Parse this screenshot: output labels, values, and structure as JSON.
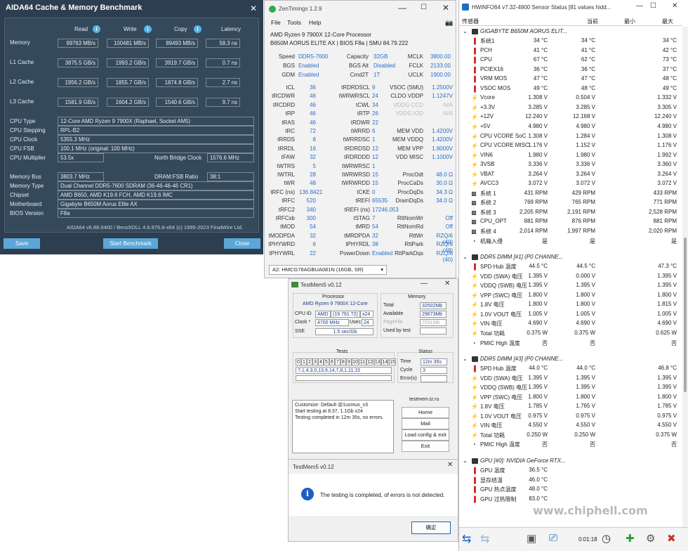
{
  "aida": {
    "title": "AIDA64 Cache & Memory Benchmark",
    "headers": {
      "read": "Read",
      "write": "Write",
      "copy": "Copy",
      "latency": "Latency"
    },
    "rows": [
      {
        "label": "Memory",
        "read": "99763 MB/s",
        "write": "100481 MB/s",
        "copy": "89493 MB/s",
        "latency": "58.3 ns"
      },
      {
        "label": "L1 Cache",
        "read": "3875.5 GB/s",
        "write": "1993.2 GB/s",
        "copy": "3919.7 GB/s",
        "latency": "0.7 ns"
      },
      {
        "label": "L2 Cache",
        "read": "1956.2 GB/s",
        "write": "1855.7 GB/s",
        "copy": "1874.8 GB/s",
        "latency": "2.7 ns"
      },
      {
        "label": "L3 Cache",
        "read": "1581.9 GB/s",
        "write": "1604.2 GB/s",
        "copy": "1540.6 GB/s",
        "latency": "9.7 ns"
      }
    ],
    "cpu_type_label": "CPU Type",
    "cpu_type": "12-Core AMD Ryzen 9 7900X  (Raphael, Socket AM5)",
    "cpu_stepping_label": "CPU Stepping",
    "cpu_stepping": "RPL-B2",
    "cpu_clock_label": "CPU Clock",
    "cpu_clock": "5355.3 MHz",
    "cpu_fsb_label": "CPU FSB",
    "cpu_fsb": "100.1 MHz  (original: 100 MHz)",
    "cpu_mult_label": "CPU Multiplier",
    "cpu_mult": "53.5x",
    "nb_clock_label": "North Bridge Clock",
    "nb_clock": "1576.6 MHz",
    "mem_bus_label": "Memory Bus",
    "mem_bus": "3803.7 MHz",
    "dram_ratio_label": "DRAM:FSB Ratio",
    "dram_ratio": "38:1",
    "mem_type_label": "Memory Type",
    "mem_type": "Dual Channel DDR5-7600 SDRAM  (36-46-46-46 CR1)",
    "chipset_label": "Chipset",
    "chipset": "AMD B650, AMD K19.6 FCH, AMD K19.6 IMC",
    "mobo_label": "Motherboard",
    "mobo": "Gigabyte B650M Aorus Elite AX",
    "bios_label": "BIOS Version",
    "bios": "F8a",
    "footer": "AIDA64 v6.88.6400 / BenchDLL 4.6.876.8-x64  (c) 1995-2023 FinalWire Ltd.",
    "save": "Save",
    "start": "Start Benchmark",
    "close": "Close"
  },
  "zen": {
    "title": "ZenTimings 1.2.9",
    "menu": [
      "File",
      "Tools",
      "Help"
    ],
    "cpu": "AMD Ryzen 9 7900X 12-Core Processor",
    "board": "B650M AORUS ELITE AX | BIOS F8a | SMU 84.79.222",
    "top": [
      [
        "Speed",
        "DDR5-7600",
        "Capacity",
        "32GB",
        "MCLK",
        "3800.00"
      ],
      [
        "BGS",
        "Enabled",
        "BGS Alt",
        "Disabled",
        "FCLK",
        "2133.00"
      ],
      [
        "GDM",
        "Enabled",
        "Cmd2T",
        "1T",
        "UCLK",
        "1900.00"
      ]
    ],
    "timings": [
      [
        "tCL",
        "36",
        "tRDRDSCL",
        "9",
        "VSOC (SMU)",
        "1.2500V"
      ],
      [
        "tRCDWR",
        "46",
        "tWRWRSCL",
        "24",
        "CLDO VDDP",
        "1.1247V"
      ],
      [
        "tRCDRD",
        "46",
        "tCWL",
        "34",
        "VDDG CCD",
        "N/A"
      ],
      [
        "tRP",
        "46",
        "tRTP",
        "26",
        "VDDG IOD",
        "N/A"
      ],
      [
        "tRAS",
        "46",
        "tRDWR",
        "22",
        "",
        ""
      ],
      [
        "tRC",
        "72",
        "tWRRD",
        "6",
        "MEM VDD",
        "1.4200V"
      ],
      [
        "tRRDS",
        "8",
        "tWRRDSC",
        "1",
        "MEM VDDQ",
        "1.4200V"
      ],
      [
        "tRRDL",
        "16",
        "tRDRDSD",
        "12",
        "MEM VPP",
        "1.8000V"
      ],
      [
        "tFAW",
        "32",
        "tRDRDDD",
        "12",
        "VDD MISC",
        "1.1000V"
      ],
      [
        "tWTRS",
        "5",
        "tWRWRSC",
        "1",
        "",
        ""
      ],
      [
        "tWTRL",
        "28",
        "tWRWRSD",
        "15",
        "ProcOdt",
        "48.0 Ω"
      ],
      [
        "tWR",
        "48",
        "tWRWRDD",
        "15",
        "ProcCaDs",
        "30.0 Ω"
      ],
      [
        "tRFC (ns)",
        "136.8421",
        "tCKE",
        "0",
        "ProcDqDs",
        "34.3 Ω"
      ],
      [
        "tRFC",
        "520",
        "tREFI",
        "65535",
        "DramDqDs",
        "34.0 Ω"
      ],
      [
        "tRFC2",
        "340",
        "tREFI (ns)",
        "17246.053",
        "",
        ""
      ],
      [
        "tRFCsb",
        "300",
        "tSTAG",
        "7",
        "RttNomWr",
        "Off"
      ],
      [
        "tMOD",
        "54",
        "tMRD",
        "54",
        "RttNomRd",
        "Off"
      ],
      [
        "tMODPDA",
        "32",
        "tMRDPDA",
        "32",
        "RttWr",
        "RZQ/6 (40)"
      ],
      [
        "tPHYWRD",
        "6",
        "tPHYRDL",
        "38",
        "RttPark",
        "RZQ/5 (48)"
      ],
      [
        "tPHYWRL",
        "22",
        "PowerDown",
        "Enabled",
        "RttParkDqs",
        "RZQ/6 (40)"
      ]
    ],
    "dimm": "A2: HMCG78AGBUA081N (16GB, SR)"
  },
  "tm5": {
    "title": "TestMem5 v0.12",
    "processor_label": "Processor",
    "processor": "AMD Ryzen 9 7900X 12-Core",
    "cpuid_label": "CPU ID",
    "cpuid_vendor": "AMD",
    "cpuid": "(19 761 ?2)",
    "cpuid_threads": "x24",
    "clock_label": "Clock *",
    "clock": "4700 MHz",
    "usec_label": "Usec",
    "usec": "24",
    "sse_label": "SSE",
    "sse": "1.5 sec/Gb",
    "memory_label": "Memory",
    "total_label": "Total",
    "total": "32502Mb",
    "avail_label": "Available",
    "avail": "29673Mb",
    "pagefile_label": "PageFile",
    "pagefile": "7031Mb",
    "used_label": "Used by test",
    "used": "",
    "tests_label": "Tests",
    "test_nums": [
      "0",
      "1",
      "2",
      "3",
      "4",
      "5",
      "6",
      "7",
      "8",
      "9",
      "10",
      "11",
      "12",
      "13",
      "14",
      "15"
    ],
    "test_seq": "?,1,4,3,0,13,9,14,7,8,1,11,15",
    "status_label": "Status",
    "time_label": "Time",
    "time": "12m 35s",
    "cycle_label": "Cycle",
    "cycle": "3",
    "errors_label": "Error(s)",
    "errors": "",
    "log": [
      "Customize: Default @1usmus_v3",
      "Start testing at 8:37, 1.1Gb x24",
      "Testing completed in 12m 35s, no errors."
    ],
    "site": "testmem.tz.ru",
    "home": "Home",
    "mail": "Mail",
    "load": "Load config & exit",
    "exit": "Exit"
  },
  "dialog": {
    "title": "TestMem5 v0.12",
    "message": "The testing is completed, of errors is not detected.",
    "ok": "确定"
  },
  "hw": {
    "title": "HWiNFO64 v7.32-4900 Sensor Status [81 values hidd...",
    "col_sensor": "传感器",
    "col_cur": "当前",
    "col_min": "最小",
    "col_max": "最大",
    "groups": [
      {
        "name": "GIGABYTE B650M AORUS ELIT...",
        "rows": [
          {
            "icon": "temp",
            "n": "系统1",
            "c": "34 °C",
            "mn": "34 °C",
            "mx": "34 °C"
          },
          {
            "icon": "temp",
            "n": "PCH",
            "c": "41 °C",
            "mn": "41 °C",
            "mx": "42 °C"
          },
          {
            "icon": "temp",
            "n": "CPU",
            "c": "67 °C",
            "mn": "62 °C",
            "mx": "73 °C"
          },
          {
            "icon": "temp",
            "n": "PCIEX16",
            "c": "36 °C",
            "mn": "36 °C",
            "mx": "37 °C"
          },
          {
            "icon": "temp",
            "n": "VRM MOS",
            "c": "47 °C",
            "mn": "47 °C",
            "mx": "48 °C"
          },
          {
            "icon": "temp",
            "n": "VSOC MOS",
            "c": "49 °C",
            "mn": "48 °C",
            "mx": "49 °C"
          },
          {
            "icon": "volt",
            "n": "Vcore",
            "c": "1.308 V",
            "mn": "0.504 V",
            "mx": "1.332 V"
          },
          {
            "icon": "volt",
            "n": "+3.3V",
            "c": "3.285 V",
            "mn": "3.285 V",
            "mx": "3.305 V"
          },
          {
            "icon": "volt",
            "n": "+12V",
            "c": "12.240 V",
            "mn": "12.168 V",
            "mx": "12.240 V"
          },
          {
            "icon": "volt",
            "n": "+5V",
            "c": "4.980 V",
            "mn": "4.980 V",
            "mx": "4.980 V"
          },
          {
            "icon": "volt",
            "n": "CPU VCORE SoC",
            "c": "1.308 V",
            "mn": "1.284 V",
            "mx": "1.308 V"
          },
          {
            "icon": "volt",
            "n": "CPU VCORE MISC",
            "c": "1.176 V",
            "mn": "1.152 V",
            "mx": "1.176 V"
          },
          {
            "icon": "volt",
            "n": "VIN6",
            "c": "1.980 V",
            "mn": "1.980 V",
            "mx": "1.992 V"
          },
          {
            "icon": "volt",
            "n": "3VSB",
            "c": "3.336 V",
            "mn": "3.336 V",
            "mx": "3.360 V"
          },
          {
            "icon": "volt",
            "n": "VBAT",
            "c": "3.264 V",
            "mn": "3.264 V",
            "mx": "3.264 V"
          },
          {
            "icon": "volt",
            "n": "AVCC3",
            "c": "3.072 V",
            "mn": "3.072 V",
            "mx": "3.072 V"
          },
          {
            "icon": "fan",
            "n": "系统 1",
            "c": "431 RPM",
            "mn": "429 RPM",
            "mx": "433 RPM"
          },
          {
            "icon": "fan",
            "n": "系统 2",
            "c": "769 RPM",
            "mn": "765 RPM",
            "mx": "771 RPM"
          },
          {
            "icon": "fan",
            "n": "系统 3",
            "c": "2,205 RPM",
            "mn": "2,191 RPM",
            "mx": "2,528 RPM"
          },
          {
            "icon": "fan",
            "n": "CPU_OPT",
            "c": "881 RPM",
            "mn": "876 RPM",
            "mx": "881 RPM"
          },
          {
            "icon": "fan",
            "n": "系统 4",
            "c": "2,014 RPM",
            "mn": "1,997 RPM",
            "mx": "2,020 RPM"
          },
          {
            "icon": "other",
            "n": "机箱入侵",
            "c": "是",
            "mn": "是",
            "mx": "是"
          }
        ]
      },
      {
        "name": "DDR5 DIMM [#1] (P0 CHANNE...",
        "rows": [
          {
            "icon": "temp",
            "n": "SPD Hub 温度",
            "c": "44.5 °C",
            "mn": "44.5 °C",
            "mx": "47.3 °C"
          },
          {
            "icon": "volt",
            "n": "VDD (SWA) 电压",
            "c": "1.395 V",
            "mn": "0.000 V",
            "mx": "1.395 V"
          },
          {
            "icon": "volt",
            "n": "VDDQ (SWB) 电压",
            "c": "1.395 V",
            "mn": "1.395 V",
            "mx": "1.395 V"
          },
          {
            "icon": "volt",
            "n": "VPP (SWC) 电压",
            "c": "1.800 V",
            "mn": "1.800 V",
            "mx": "1.800 V"
          },
          {
            "icon": "volt",
            "n": "1.8V 电压",
            "c": "1.800 V",
            "mn": "1.800 V",
            "mx": "1.815 V"
          },
          {
            "icon": "volt",
            "n": "1.0V VOUT 电压",
            "c": "1.005 V",
            "mn": "1.005 V",
            "mx": "1.005 V"
          },
          {
            "icon": "volt",
            "n": "VIN 电压",
            "c": "4.690 V",
            "mn": "4.690 V",
            "mx": "4.690 V"
          },
          {
            "icon": "power",
            "n": "Total 功耗",
            "c": "0.375 W",
            "mn": "0.375 W",
            "mx": "0.625 W"
          },
          {
            "icon": "other",
            "n": "PMIC High 温度",
            "c": "否",
            "mn": "否",
            "mx": "否"
          }
        ]
      },
      {
        "name": "DDR5 DIMM [#3] (P0 CHANNE...",
        "rows": [
          {
            "icon": "temp",
            "n": "SPD Hub 温度",
            "c": "44.0 °C",
            "mn": "44.0 °C",
            "mx": "46.8 °C"
          },
          {
            "icon": "volt",
            "n": "VDD (SWA) 电压",
            "c": "1.395 V",
            "mn": "1.395 V",
            "mx": "1.395 V"
          },
          {
            "icon": "volt",
            "n": "VDDQ (SWB) 电压",
            "c": "1.395 V",
            "mn": "1.395 V",
            "mx": "1.395 V"
          },
          {
            "icon": "volt",
            "n": "VPP (SWC) 电压",
            "c": "1.800 V",
            "mn": "1.800 V",
            "mx": "1.800 V"
          },
          {
            "icon": "volt",
            "n": "1.8V 电压",
            "c": "1.785 V",
            "mn": "1.765 V",
            "mx": "1.785 V"
          },
          {
            "icon": "volt",
            "n": "1.0V VOUT 电压",
            "c": "0.975 V",
            "mn": "0.975 V",
            "mx": "0.975 V"
          },
          {
            "icon": "volt",
            "n": "VIN 电压",
            "c": "4.550 V",
            "mn": "4.550 V",
            "mx": "4.550 V"
          },
          {
            "icon": "power",
            "n": "Total 功耗",
            "c": "0.250 W",
            "mn": "0.250 W",
            "mx": "0.375 W"
          },
          {
            "icon": "other",
            "n": "PMIC High 温度",
            "c": "否",
            "mn": "否",
            "mx": "否"
          }
        ]
      },
      {
        "name": "GPU [#0]: NVIDIA GeForce RTX...",
        "rows": [
          {
            "icon": "temp",
            "n": "GPU 温度",
            "c": "36.5 °C",
            "mn": "",
            "mx": ""
          },
          {
            "icon": "temp",
            "n": "显存结温",
            "c": "46.0 °C",
            "mn": "",
            "mx": ""
          },
          {
            "icon": "temp",
            "n": "GPU 热点温度",
            "c": "48.0 °C",
            "mn": "",
            "mx": ""
          },
          {
            "icon": "temp",
            "n": "GPU 过热限制",
            "c": "83.0 °C",
            "mn": "",
            "mx": ""
          }
        ]
      }
    ],
    "timer": "0:01:18",
    "watermark": "www.chiphell.com"
  }
}
